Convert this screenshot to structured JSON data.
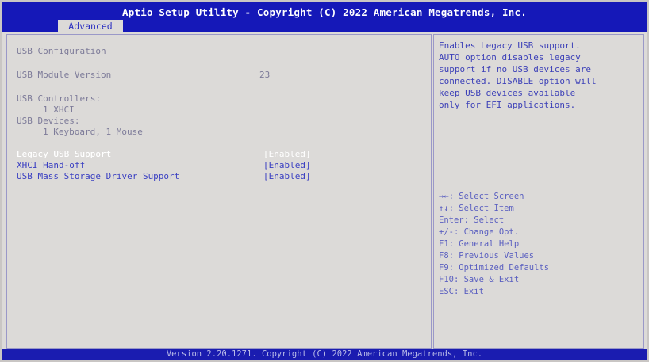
{
  "header": {
    "title": "Aptio Setup Utility - Copyright (C) 2022 American Megatrends, Inc.",
    "tab": "Advanced"
  },
  "main": {
    "section_title": "USB Configuration",
    "module_version_label": "USB Module Version",
    "module_version_value": "23",
    "controllers_label": "USB Controllers:",
    "controllers_value": "1 XHCI",
    "devices_label": "USB Devices:",
    "devices_value": "1 Keyboard, 1 Mouse",
    "settings": [
      {
        "label": "Legacy USB Support",
        "value": "[Enabled]"
      },
      {
        "label": "XHCI Hand-off",
        "value": "[Enabled]"
      },
      {
        "label": "USB Mass Storage Driver Support",
        "value": "[Enabled]"
      }
    ]
  },
  "help": {
    "lines": [
      "Enables Legacy USB support.",
      "AUTO option disables legacy",
      "support if no USB devices are",
      "connected. DISABLE option will",
      "keep USB devices available",
      "only for EFI applications."
    ]
  },
  "keys": [
    "→←: Select Screen",
    "↑↓: Select Item",
    "Enter: Select",
    "+/-: Change Opt.",
    "F1: General Help",
    "F8: Previous Values",
    "F9: Optimized Defaults",
    "F10: Save & Exit",
    "ESC: Exit"
  ],
  "footer": {
    "text": "Version 2.20.1271. Copyright (C) 2022 American Megatrends, Inc."
  }
}
